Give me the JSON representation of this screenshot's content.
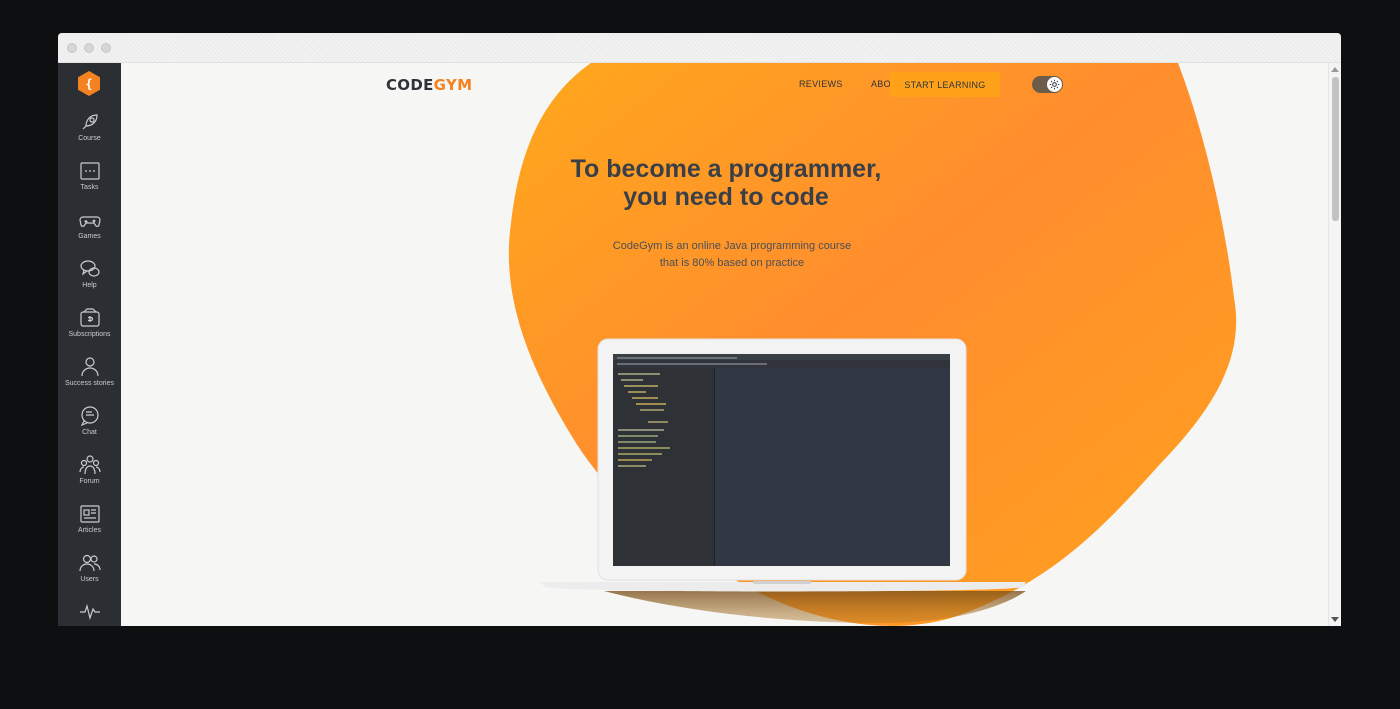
{
  "window": {
    "controls": [
      "close",
      "minimize",
      "maximize"
    ]
  },
  "sidebar": {
    "logo_glyph": "{",
    "items": [
      {
        "label": "Course",
        "icon": "rocket-icon"
      },
      {
        "label": "Tasks",
        "icon": "tasks-icon"
      },
      {
        "label": "Games",
        "icon": "gamepad-icon"
      },
      {
        "label": "Help",
        "icon": "help-chat-icon"
      },
      {
        "label": "Subscriptions",
        "icon": "wallet-icon"
      },
      {
        "label": "Success stories",
        "icon": "person-icon"
      },
      {
        "label": "Chat",
        "icon": "chat-icon"
      },
      {
        "label": "Forum",
        "icon": "group-icon"
      },
      {
        "label": "Articles",
        "icon": "articles-icon"
      },
      {
        "label": "Users",
        "icon": "users-icon"
      },
      {
        "label": "",
        "icon": "activity-icon"
      }
    ]
  },
  "header": {
    "brand_part1": "CODE",
    "brand_part2": "GYM",
    "nav": {
      "reviews": "REVIEWS",
      "about": "ABOUT US"
    },
    "cta": "START LEARNING",
    "theme_toggle_icon": "gear-icon"
  },
  "hero": {
    "title_line1": "To become a programmer,",
    "title_line2": "you need to code",
    "subtitle_line1": "CodeGym is an online Java programming course",
    "subtitle_line2": "that is 80% based on practice"
  },
  "colors": {
    "sidebar": "#2b2e33",
    "accent": "#f58220",
    "cta": "#ffa21a",
    "text": "#2f3339",
    "ide_editor": "#323843"
  }
}
